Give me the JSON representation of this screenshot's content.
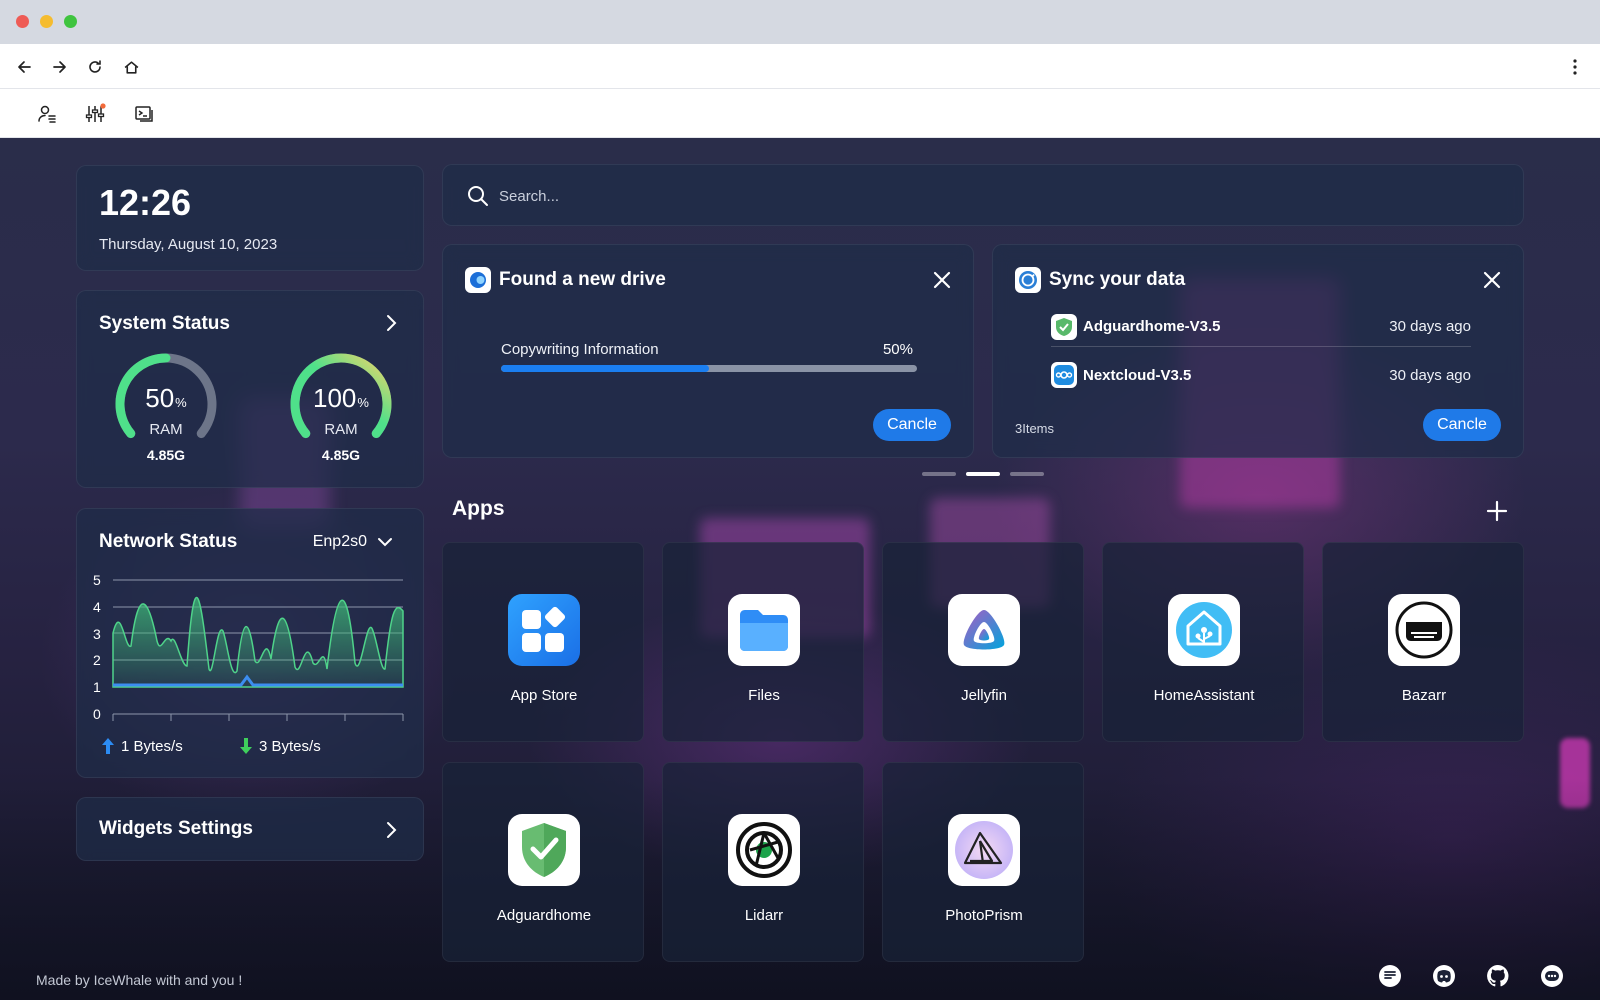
{
  "browser": {
    "back_icon": "back-arrow-icon",
    "forward_icon": "forward-arrow-icon",
    "reload_icon": "reload-icon",
    "home_icon": "home-icon",
    "menu_icon": "more-vertical-icon"
  },
  "toolbar": {
    "items": [
      "account-icon",
      "settings-sliders-icon",
      "terminal-icon"
    ],
    "notification_color": "#f26a3a"
  },
  "clock": {
    "time": "12:26",
    "date": "Thursday, August 10, 2023"
  },
  "system_status": {
    "title": "System Status",
    "gauges": [
      {
        "value": "50",
        "unit": "%",
        "label": "RAM",
        "size": "4.85G",
        "fraction": 0.5
      },
      {
        "value": "100",
        "unit": "%",
        "label": "RAM",
        "size": "4.85G",
        "fraction": 1.0
      }
    ]
  },
  "network_status": {
    "title": "Network Status",
    "interface": "Enp2s0",
    "y_ticks": [
      "5",
      "4",
      "3",
      "2",
      "1",
      "0"
    ],
    "upload": "1 Bytes/s",
    "download": "3 Bytes/s"
  },
  "widgets_settings": {
    "title": "Widgets Settings"
  },
  "search": {
    "placeholder": "Search..."
  },
  "drive_card": {
    "title": "Found a new drive",
    "progress_label": "Copywriting Information",
    "progress_text": "50%",
    "progress": 0.5,
    "button": "Cancle"
  },
  "sync_card": {
    "title": "Sync your data",
    "items": [
      {
        "name": "Adguardhome-V3.5",
        "time": "30 days ago"
      },
      {
        "name": "Nextcloud-V3.5",
        "time": "30 days ago"
      }
    ],
    "count": "3Items",
    "button": "Cancle"
  },
  "apps": {
    "title": "Apps",
    "list": [
      {
        "label": "App Store"
      },
      {
        "label": "Files"
      },
      {
        "label": "Jellyfin"
      },
      {
        "label": "HomeAssistant"
      },
      {
        "label": "Bazarr"
      },
      {
        "label": "Adguardhome"
      },
      {
        "label": "Lidarr"
      },
      {
        "label": "PhotoPrism"
      }
    ]
  },
  "footer": {
    "text": "Made by IceWhale with and you !",
    "icons": [
      "chat-icon",
      "discord-icon",
      "github-icon",
      "message-icon"
    ]
  },
  "colors": {
    "accent": "#1f7ae8",
    "gauge_green": "#4fe08a",
    "gauge_yellow": "#f1d46a"
  }
}
